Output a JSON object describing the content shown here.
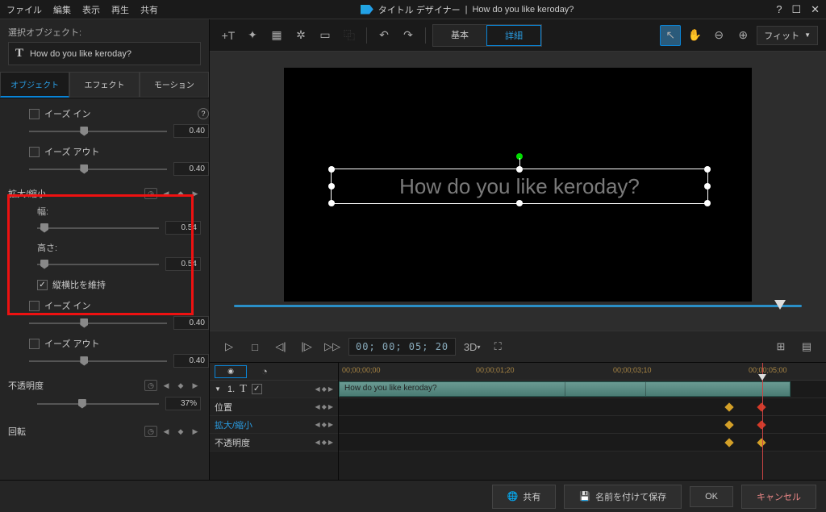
{
  "menubar": {
    "file": "ファイル",
    "edit": "編集",
    "view": "表示",
    "play": "再生",
    "share": "共有"
  },
  "title": {
    "app": "タイトル デザイナー",
    "sep": "|",
    "doc": "How do you like keroday?"
  },
  "window": {
    "help": "?",
    "max": "☐",
    "close": "✕"
  },
  "left": {
    "selected_label": "選択オブジェクト:",
    "selected_value": "How do you like keroday?",
    "tabs": {
      "object": "オブジェクト",
      "effect": "エフェクト",
      "motion": "モーション"
    },
    "ease_in": "イーズ イン",
    "ease_out": "イーズ アウト",
    "ease_val1": "0.40",
    "ease_val2": "0.40",
    "ease_val3": "0.40",
    "ease_val4": "0.40",
    "scale_header": "拡大/縮小",
    "width_label": "幅:",
    "width_val": "0.54",
    "height_label": "高さ:",
    "height_val": "0.54",
    "aspect": "縦横比を維持",
    "opacity_header": "不透明度",
    "opacity_val": "37%",
    "rotation_header": "回転"
  },
  "toolbar": {
    "basic": "基本",
    "advanced": "詳細",
    "zoom": "フィット"
  },
  "preview": {
    "text": "How do you like keroday?"
  },
  "transport": {
    "timecode": "00; 00; 05; 20",
    "three_d": "3D"
  },
  "timeline": {
    "ruler": {
      "t0": "00;00;00;00",
      "t1": "00;00;01;20",
      "t2": "00;00;03;10",
      "t3": "00;00;05;00"
    },
    "track_num": "1.",
    "clip": "How do you like keroday?",
    "pos": "位置",
    "scale": "拡大/縮小",
    "opacity": "不透明度"
  },
  "bottom": {
    "share": "共有",
    "saveas": "名前を付けて保存",
    "ok": "OK",
    "cancel": "キャンセル"
  }
}
